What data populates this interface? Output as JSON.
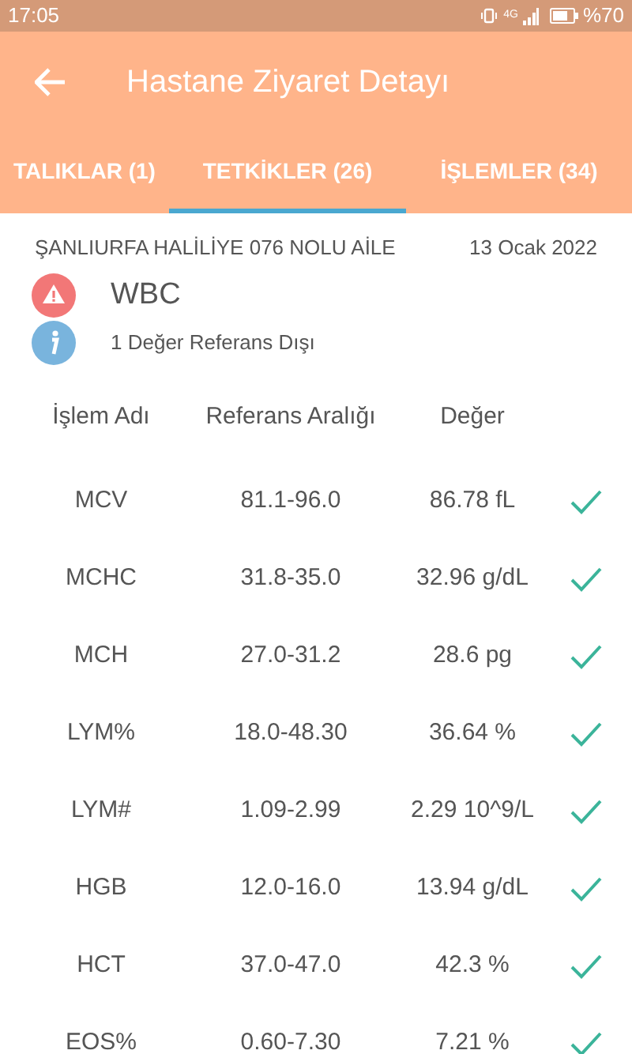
{
  "status_bar": {
    "time": "17:05",
    "network": "4G",
    "battery": "%70"
  },
  "header": {
    "title": "Hastane Ziyaret Detayı"
  },
  "tabs": [
    {
      "label": "TALIKLAR (1)",
      "selected": false
    },
    {
      "label": "TETKİKLER (26)",
      "selected": true
    },
    {
      "label": "İŞLEMLER (34)",
      "selected": false
    }
  ],
  "visit": {
    "facility": "ŞANLIURFA HALİLİYE 076 NOLU AİLE",
    "date": "13 Ocak 2022",
    "warning": "WBC",
    "info": "1 Değer Referans Dışı"
  },
  "table": {
    "columns": [
      "İşlem Adı",
      "Referans Aralığı",
      "Değer"
    ],
    "rows": [
      {
        "name": "MCV",
        "range": "81.1-96.0",
        "value": "86.78 fL",
        "in_range": true
      },
      {
        "name": "MCHC",
        "range": "31.8-35.0",
        "value": "32.96 g/dL",
        "in_range": true
      },
      {
        "name": "MCH",
        "range": "27.0-31.2",
        "value": "28.6 pg",
        "in_range": true
      },
      {
        "name": "LYM%",
        "range": "18.0-48.30",
        "value": "36.64 %",
        "in_range": true
      },
      {
        "name": "LYM#",
        "range": "1.09-2.99",
        "value": "2.29 10^9/L",
        "in_range": true
      },
      {
        "name": "HGB",
        "range": "12.0-16.0",
        "value": "13.94 g/dL",
        "in_range": true
      },
      {
        "name": "HCT",
        "range": "37.0-47.0",
        "value": "42.3 %",
        "in_range": true
      },
      {
        "name": "EOS%",
        "range": "0.60-7.30",
        "value": "7.21 %",
        "in_range": true
      }
    ]
  }
}
